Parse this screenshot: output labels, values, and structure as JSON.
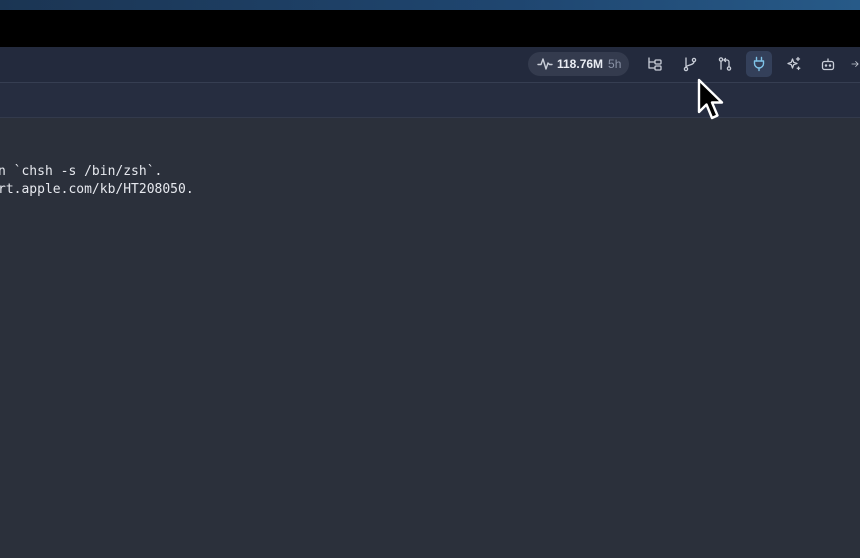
{
  "toolbar": {
    "usage": {
      "value": "118.76M",
      "period": "5h",
      "icon": "activity-pulse-icon"
    },
    "buttons": [
      {
        "icon": "file-tree-icon",
        "active": false
      },
      {
        "icon": "git-branch-icon",
        "active": false
      },
      {
        "icon": "git-pull-request-icon",
        "active": false
      },
      {
        "icon": "plug-icon",
        "active": true
      },
      {
        "icon": "sparkles-icon",
        "active": false
      },
      {
        "icon": "bot-icon",
        "active": false
      }
    ]
  },
  "terminal": {
    "lines": [
      "n `chsh -s /bin/zsh`.",
      "rt.apple.com/kb/HT208050."
    ]
  },
  "colors": {
    "accent_active": "#7fc3e8",
    "toolbar_bg": "#232a3d",
    "terminal_bg": "#2b303b"
  }
}
